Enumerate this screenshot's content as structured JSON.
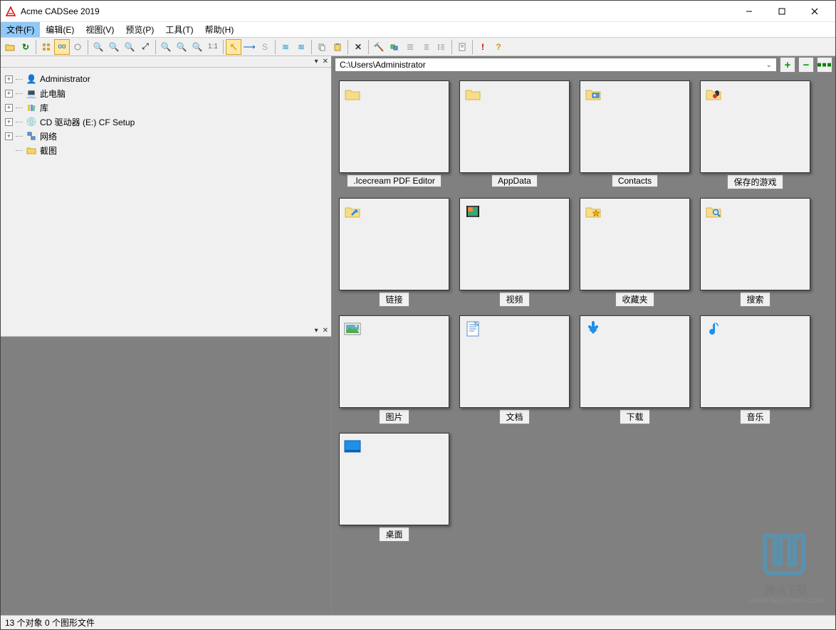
{
  "window": {
    "title": "Acme CADSee 2019"
  },
  "menu": {
    "file": "文件(F)",
    "edit": "编辑(E)",
    "view": "视图(V)",
    "preview": "预览(P)",
    "tools": "工具(T)",
    "help": "帮助(H)"
  },
  "tree": {
    "nodes": [
      {
        "label": "Administrator",
        "icon": "user"
      },
      {
        "label": "此电脑",
        "icon": "pc"
      },
      {
        "label": "库",
        "icon": "lib"
      },
      {
        "label": "CD 驱动器 (E:) CF Setup",
        "icon": "cd"
      },
      {
        "label": "网络",
        "icon": "net"
      },
      {
        "label": "截图",
        "icon": "folder",
        "leaf": true
      }
    ]
  },
  "path": {
    "value": "C:\\Users\\Administrator"
  },
  "thumbs": [
    {
      "label": ".Icecream PDF Editor",
      "icon": "folder"
    },
    {
      "label": "AppData",
      "icon": "folder"
    },
    {
      "label": "Contacts",
      "icon": "contacts"
    },
    {
      "label": "保存的游戏",
      "icon": "games"
    },
    {
      "label": "链接",
      "icon": "links"
    },
    {
      "label": "视频",
      "icon": "video"
    },
    {
      "label": "收藏夹",
      "icon": "fav"
    },
    {
      "label": "搜索",
      "icon": "search"
    },
    {
      "label": "图片",
      "icon": "pictures"
    },
    {
      "label": "文档",
      "icon": "docs"
    },
    {
      "label": "下载",
      "icon": "download"
    },
    {
      "label": "音乐",
      "icon": "music"
    },
    {
      "label": "桌面",
      "icon": "desktop"
    }
  ],
  "status": {
    "text": "13 个对象 0 个图形文件"
  },
  "watermark": {
    "brand": "微当下载",
    "url": "WWW.WEIDOWN.COM"
  }
}
